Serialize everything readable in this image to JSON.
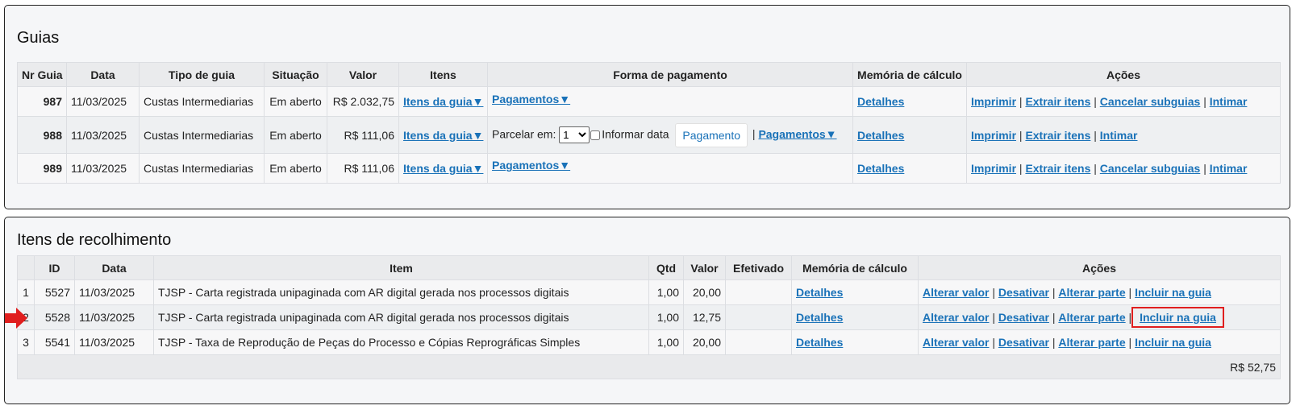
{
  "guias": {
    "title": "Guias",
    "headers": [
      "Nr Guia",
      "Data",
      "Tipo de guia",
      "Situação",
      "Valor",
      "Itens",
      "Forma de pagamento",
      "Memória de cálculo",
      "Ações"
    ],
    "rows": [
      {
        "nr": "987",
        "data": "11/03/2025",
        "tipo": "Custas Intermediarias",
        "situacao": "Em aberto",
        "valor": "R$ 2.032,75",
        "itens": "Itens da guia▼",
        "pagamentos": "Pagamentos▼",
        "memoria": "Detalhes",
        "acoes": [
          "Imprimir",
          "Extrair itens",
          "Cancelar subguias",
          "Intimar"
        ]
      },
      {
        "nr": "988",
        "data": "11/03/2025",
        "tipo": "Custas Intermediarias",
        "situacao": "Em aberto",
        "valor": "R$ 111,06",
        "itens": "Itens da guia▼",
        "parcelar_label": "Parcelar em:",
        "parcelar_value": "1",
        "informar_data": "Informar data",
        "pagamento_button": "Pagamento",
        "pagamentos": "Pagamentos▼",
        "memoria": "Detalhes",
        "acoes": [
          "Imprimir",
          "Extrair itens",
          "Intimar"
        ]
      },
      {
        "nr": "989",
        "data": "11/03/2025",
        "tipo": "Custas Intermediarias",
        "situacao": "Em aberto",
        "valor": "R$ 111,06",
        "itens": "Itens da guia▼",
        "pagamentos": "Pagamentos▼",
        "memoria": "Detalhes",
        "acoes": [
          "Imprimir",
          "Extrair itens",
          "Cancelar subguias",
          "Intimar"
        ]
      }
    ]
  },
  "itens": {
    "title": "Itens de recolhimento",
    "headers": [
      "",
      "ID",
      "Data",
      "Item",
      "Qtd",
      "Valor",
      "Efetivado",
      "Memória de cálculo",
      "Ações"
    ],
    "rows": [
      {
        "n": "1",
        "id": "5527",
        "data": "11/03/2025",
        "item": "TJSP - Carta registrada unipaginada com AR digital gerada nos processos digitais",
        "qtd": "1,00",
        "valor": "20,00",
        "efetivado": "",
        "memoria": "Detalhes",
        "acoes": [
          "Alterar valor",
          "Desativar",
          "Alterar parte",
          "Incluir na guia"
        ]
      },
      {
        "n": "2",
        "id": "5528",
        "data": "11/03/2025",
        "item": "TJSP - Carta registrada unipaginada com AR digital gerada nos processos digitais",
        "qtd": "1,00",
        "valor": "12,75",
        "efetivado": "",
        "memoria": "Detalhes",
        "acoes": [
          "Alterar valor",
          "Desativar",
          "Alterar parte",
          "Incluir na guia"
        ]
      },
      {
        "n": "3",
        "id": "5541",
        "data": "11/03/2025",
        "item": "TJSP - Taxa de Reprodução de Peças do Processo e Cópias Reprográficas Simples",
        "qtd": "1,00",
        "valor": "20,00",
        "efetivado": "",
        "memoria": "Detalhes",
        "acoes": [
          "Alterar valor",
          "Desativar",
          "Alterar parte",
          "Incluir na guia"
        ]
      }
    ],
    "total": "R$ 52,75"
  },
  "colors": {
    "link": "#1a72b8",
    "highlight": "#e01e1e",
    "arrow": "#e01e1e"
  },
  "icons": {
    "pointer": "red-arrow-icon"
  }
}
